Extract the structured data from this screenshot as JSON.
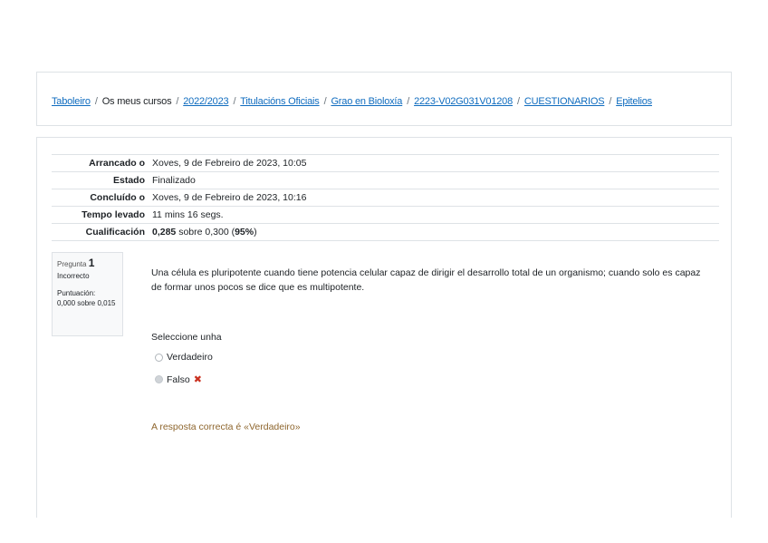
{
  "breadcrumb": {
    "items": [
      {
        "label": "Taboleiro",
        "link": true
      },
      {
        "label": "Os meus cursos",
        "link": false
      },
      {
        "label": "2022/2023",
        "link": true
      },
      {
        "label": "Titulacións Oficiais",
        "link": true
      },
      {
        "label": "Grao en Bioloxía",
        "link": true
      },
      {
        "label": "2223-V02G031V01208",
        "link": true
      },
      {
        "label": "CUESTIONARIOS",
        "link": true
      },
      {
        "label": "Epitelios",
        "link": true
      }
    ],
    "separator": "/"
  },
  "summary": {
    "started_label": "Arrancado o",
    "started_value": "Xoves, 9 de Febreiro de 2023, 10:05",
    "state_label": "Estado",
    "state_value": "Finalizado",
    "completed_label": "Concluído o",
    "completed_value": "Xoves, 9 de Febreiro de 2023, 10:16",
    "time_label": "Tempo levado",
    "time_value": "11 mins 16 segs.",
    "grade_label": "Cualificación",
    "grade_score": "0,285",
    "grade_rest": "sobre 0,300 (",
    "grade_percent": "95%",
    "grade_close": ")"
  },
  "question": {
    "label": "Pregunta",
    "number": "1",
    "state": "Incorrecto",
    "mark_label": "Puntuación:",
    "mark_value": "0,000 sobre 0,015",
    "text": "Una célula es pluripotente cuando tiene potencia celular capaz de dirigir el desarrollo total de un organismo; cuando solo es capaz de formar unos pocos se dice que es multipotente.",
    "prompt": "Seleccione unha",
    "options": [
      {
        "label": "Verdadeiro",
        "checked": false
      },
      {
        "label": "Falso",
        "checked": true
      }
    ],
    "incorrect_mark": "✖",
    "feedback": "A resposta correcta é «Verdadeiro»"
  }
}
